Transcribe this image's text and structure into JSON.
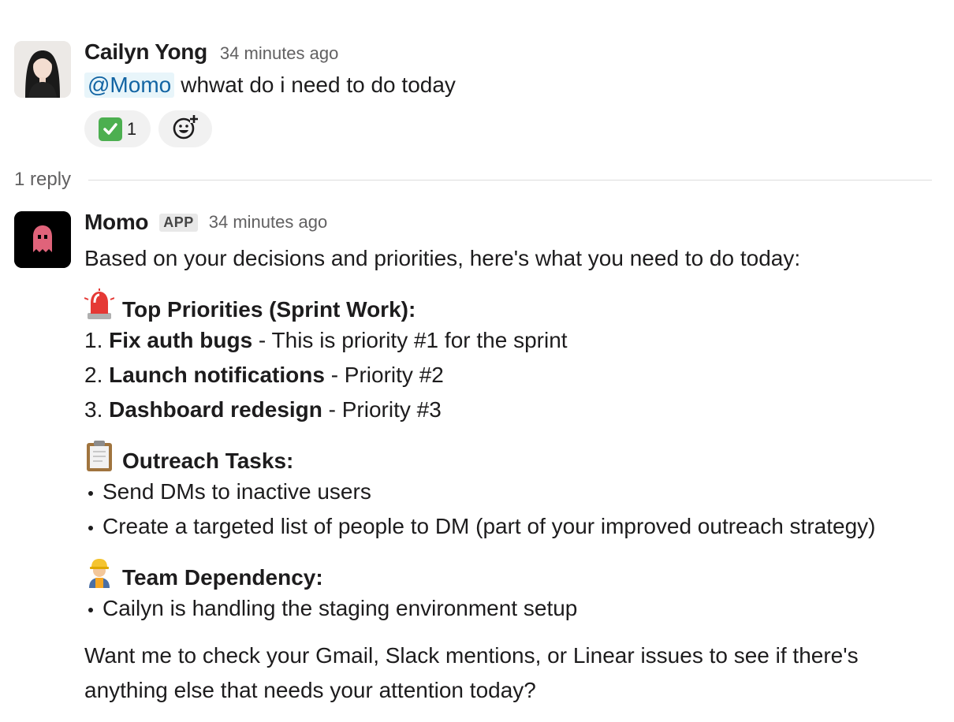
{
  "messages": [
    {
      "author": "Cailyn Yong",
      "time": "34 minutes ago",
      "mention": "@Momo",
      "text": "whwat do i need to do today",
      "reactions": [
        {
          "icon": "white-check-mark-icon",
          "count": "1"
        },
        {
          "icon": "add-reaction-icon"
        }
      ]
    },
    {
      "author": "Momo",
      "badge": "APP",
      "time": "34 minutes ago",
      "intro": "Based on your decisions and priorities, here's what you need to do today:",
      "sections": [
        {
          "icon": "rotating-light-icon",
          "title": "Top Priorities (Sprint Work):",
          "items": [
            {
              "num": "1.",
              "bold": "Fix auth bugs",
              "rest": "- This is priority #1 for the sprint"
            },
            {
              "num": "2.",
              "bold": "Launch notifications",
              "rest": "- Priority #2"
            },
            {
              "num": "3.",
              "bold": "Dashboard redesign",
              "rest": "- Priority #3"
            }
          ]
        },
        {
          "icon": "clipboard-icon",
          "title": "Outreach Tasks:",
          "items": [
            {
              "text": "Send DMs to inactive users"
            },
            {
              "text": "Create a targeted list of people to DM (part of your improved outreach strategy)"
            }
          ]
        },
        {
          "icon": "construction-worker-icon",
          "title": "Team Dependency:",
          "items": [
            {
              "text": "Cailyn is handling the staging environment setup"
            }
          ]
        }
      ],
      "closing": "Want me to check your Gmail, Slack mentions, or Linear issues to see if there's anything else that needs your attention today?"
    }
  ],
  "thread": {
    "replies_label": "1 reply"
  },
  "colors": {
    "mention": "#1264a3",
    "mention_bg": "#e8f5fa",
    "muted": "#616061",
    "ghost": "#e0637a"
  }
}
